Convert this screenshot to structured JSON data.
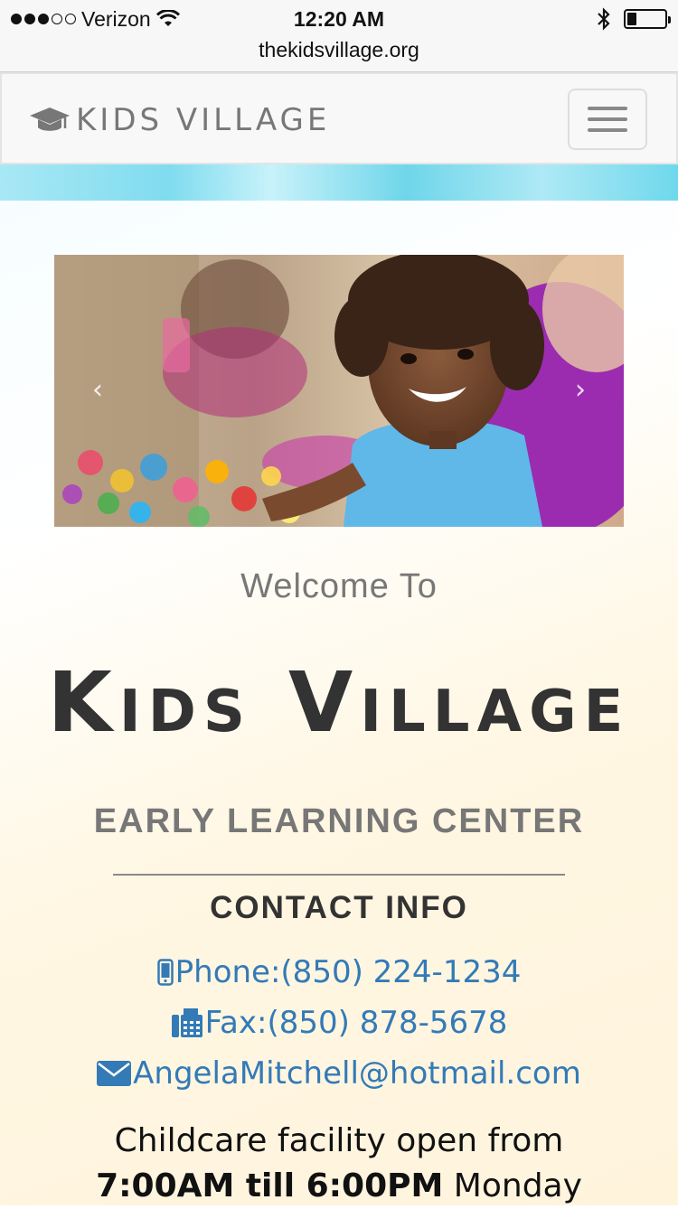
{
  "status_bar": {
    "carrier": "Verizon",
    "time": "12:20 AM",
    "url": "thekidsvillage.org",
    "signal_dots_filled": 3,
    "signal_dots_total": 5,
    "battery_level": 0.25
  },
  "navbar": {
    "brand": "KIDS VILLAGE",
    "brand_icon": "graduation-cap-icon",
    "menu_icon": "hamburger-icon"
  },
  "carousel": {
    "prev_icon": "chevron-left-icon",
    "next_icon": "chevron-right-icon",
    "prev_glyph": "‹",
    "next_glyph": "›"
  },
  "hero": {
    "welcome": "Welcome To",
    "title": "Kids Village",
    "subtitle": "EARLY LEARNING CENTER"
  },
  "contact": {
    "heading": "CONTACT INFO",
    "phone": "Phone:(850) 224-1234",
    "fax": "Fax:(850) 878-5678",
    "email": "AngelaMitchell@hotmail.com"
  },
  "hours": {
    "line1": "Childcare facility open from",
    "line2_strong": "7:00AM till 6:00PM",
    "line2_rest": " Monday"
  },
  "colors": {
    "link": "#337ab7",
    "brand_gray": "#777777",
    "title_dark": "#333333"
  }
}
